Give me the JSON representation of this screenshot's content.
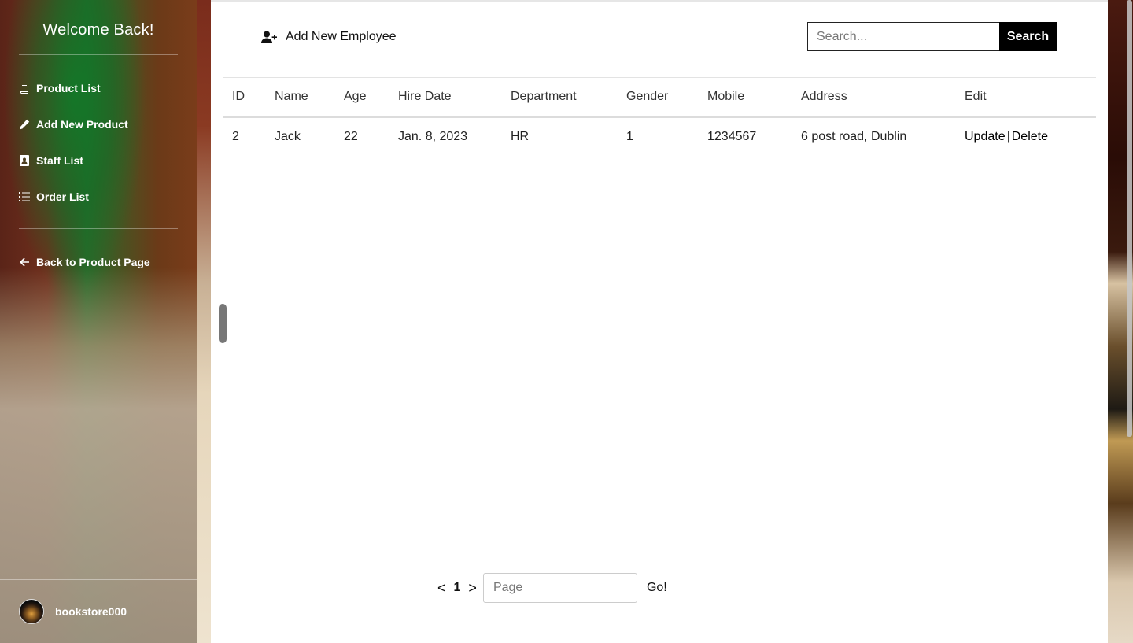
{
  "sidebar": {
    "title": "Welcome Back!",
    "items": [
      {
        "label": "Product List",
        "icon": "book-icon"
      },
      {
        "label": "Add New Product",
        "icon": "pencil-icon"
      },
      {
        "label": "Staff List",
        "icon": "address-book-icon"
      },
      {
        "label": "Order List",
        "icon": "list-icon"
      }
    ],
    "back_label": "Back to Product Page",
    "username": "bookstore000"
  },
  "toolbar": {
    "add_employee_label": "Add New Employee",
    "search_placeholder": "Search...",
    "search_label": "Search"
  },
  "table": {
    "columns": [
      "ID",
      "Name",
      "Age",
      "Hire Date",
      "Department",
      "Gender",
      "Mobile",
      "Address",
      "Edit"
    ],
    "rows": [
      {
        "id": "2",
        "name": "Jack",
        "age": "22",
        "hire_date": "Jan. 8, 2023",
        "department": "HR",
        "gender": "1",
        "mobile": "1234567",
        "address": "6 post road, Dublin",
        "update": "Update",
        "sep": "|",
        "delete": "Delete"
      }
    ]
  },
  "pagination": {
    "prev": "<",
    "current": "1",
    "next": ">",
    "page_placeholder": "Page",
    "go_label": "Go!"
  }
}
